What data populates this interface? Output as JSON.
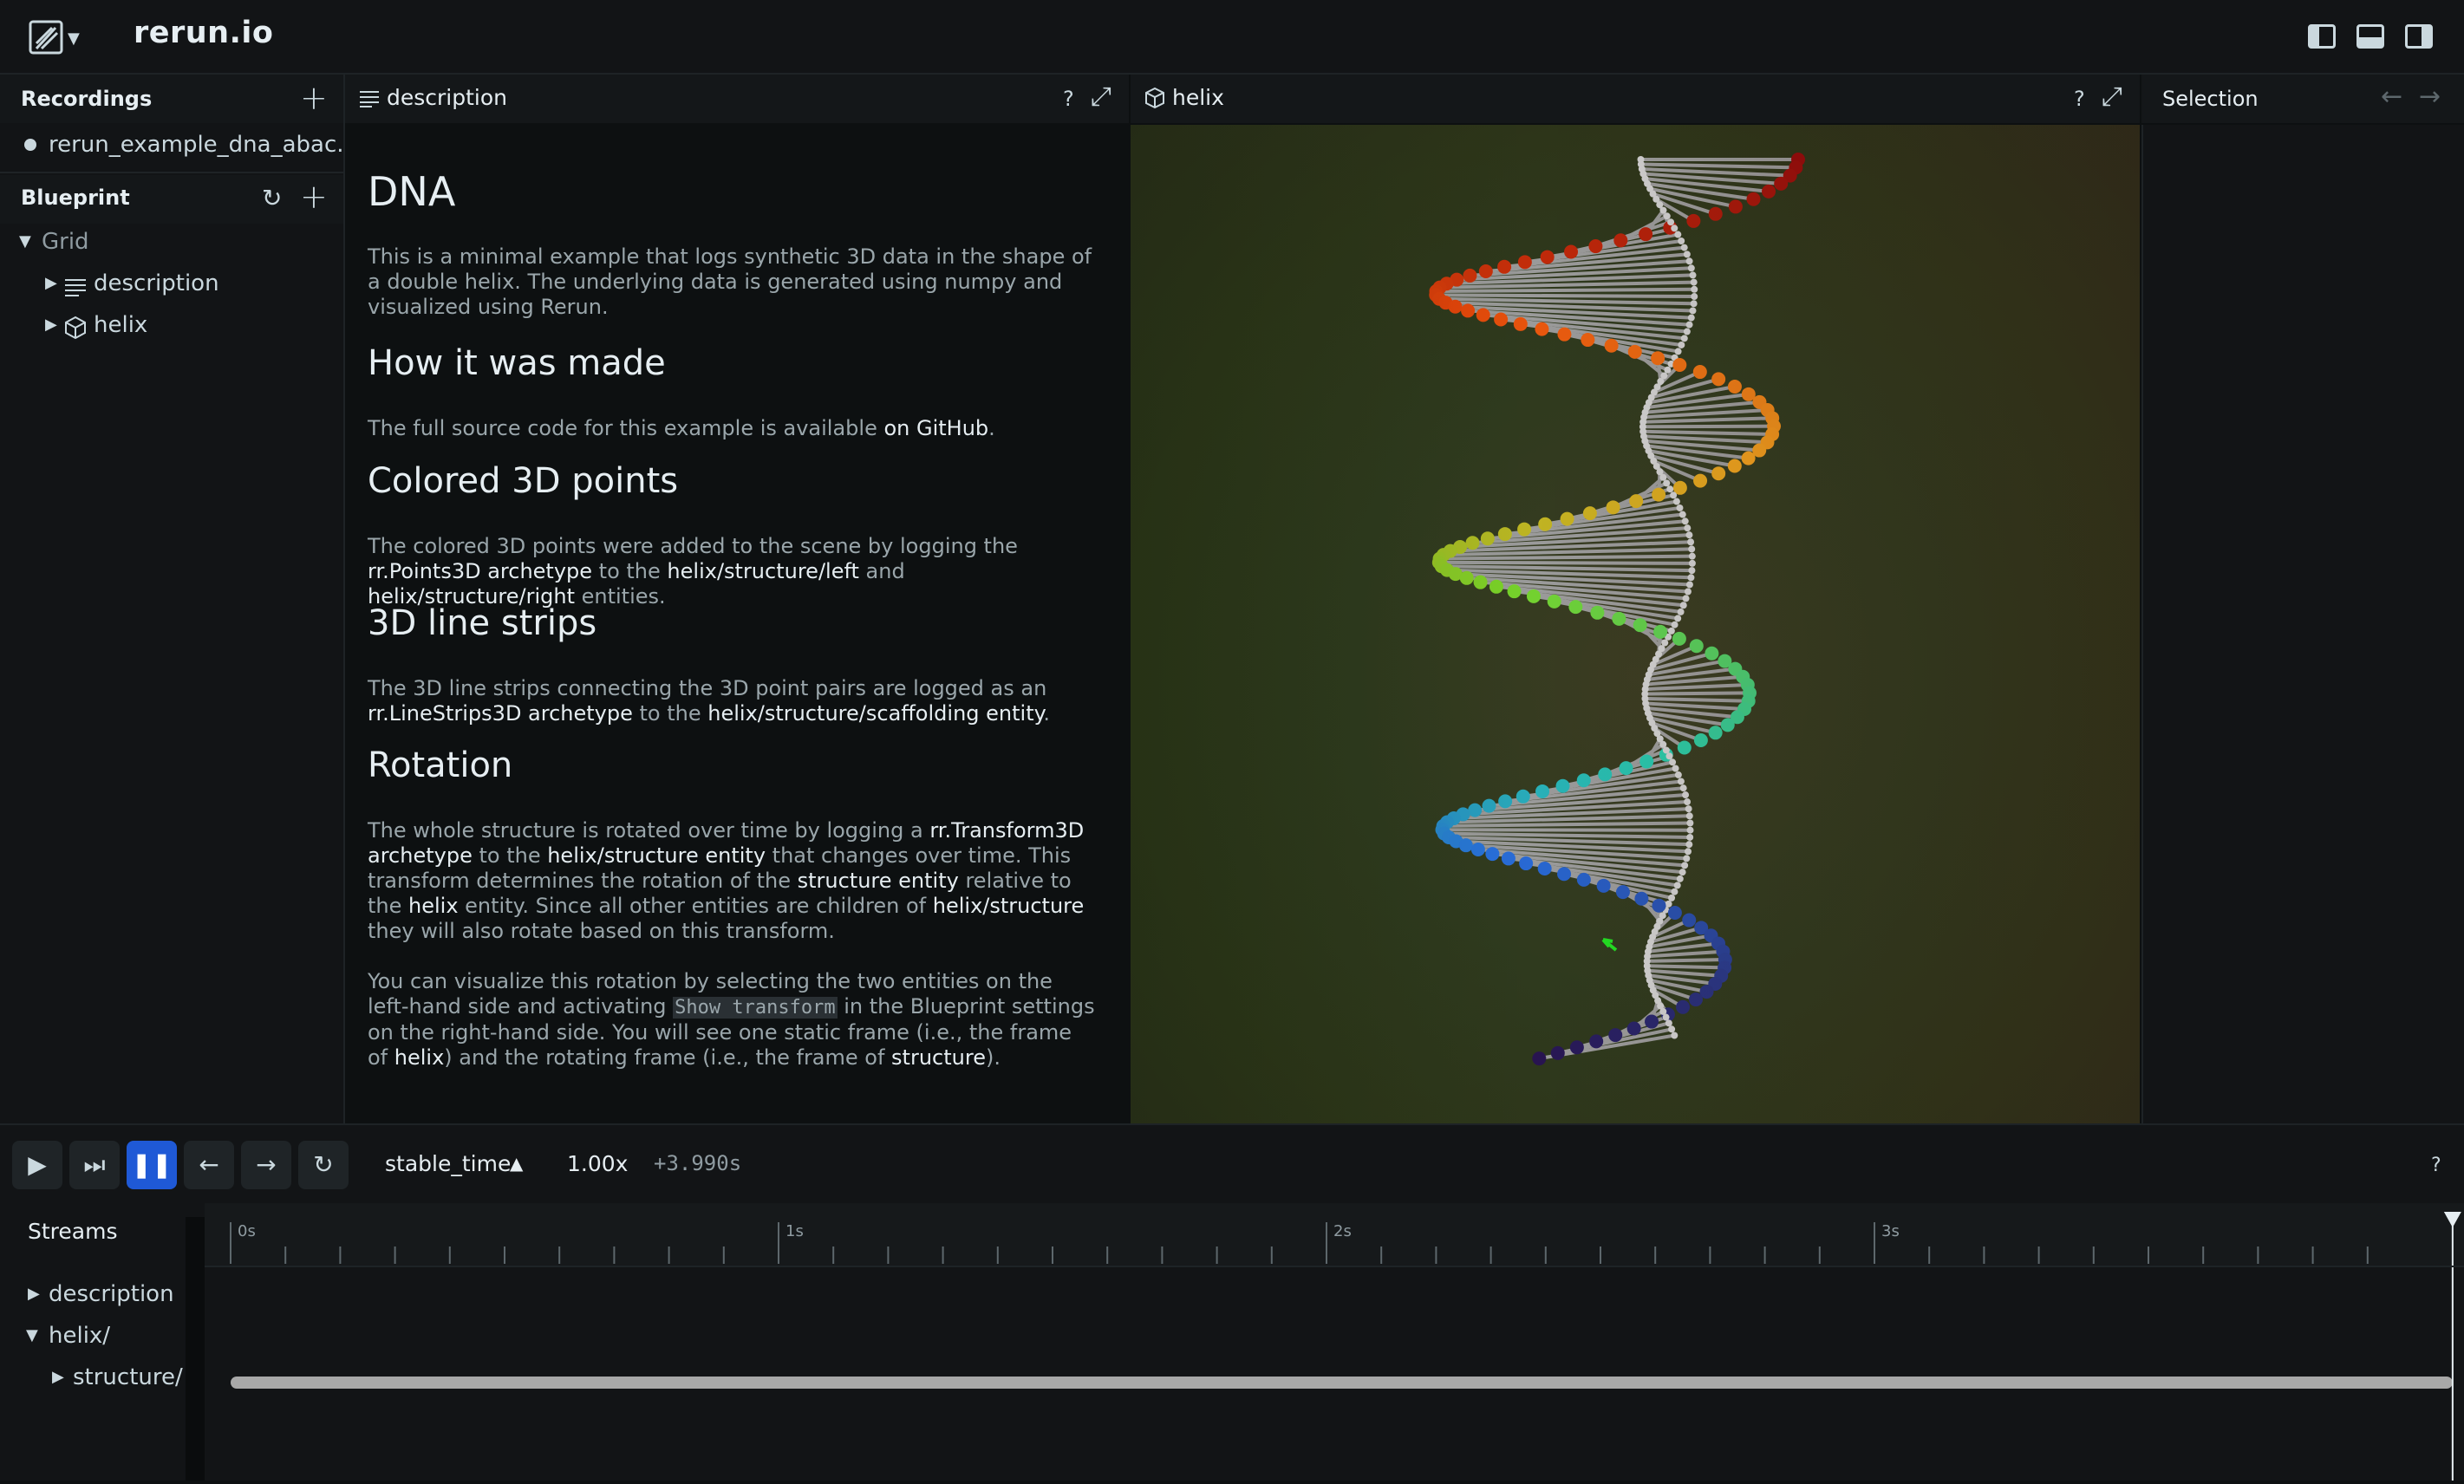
{
  "app": {
    "title": "rerun.io"
  },
  "recordings": {
    "header": "Recordings",
    "items": [
      {
        "label": "rerun_example_dna_abac..."
      }
    ]
  },
  "blueprint": {
    "header": "Blueprint",
    "tree": {
      "root": "Grid",
      "children": [
        {
          "label": "description",
          "icon": "text-icon"
        },
        {
          "label": "helix",
          "icon": "cube-icon"
        }
      ]
    }
  },
  "description_view": {
    "tab": "description",
    "help": "?",
    "md": {
      "h_dna": "DNA",
      "p_dna": "This is a minimal example that logs synthetic 3D data in the shape of a double helix. The underlying data is generated using numpy and visualized using Rerun.",
      "h_made": "How it was made",
      "p_made_pre": "The full source code for this example is available ",
      "p_made_link": "on GitHub",
      "p_made_post": ".",
      "h_points": "Colored 3D points",
      "p_points": {
        "t1": "The colored 3D points were added to the scene by logging the ",
        "b1": "rr.Points3D archetype",
        "t2": " to the ",
        "b2": "helix/structure/left",
        "t3": " and ",
        "b3": "helix/structure/right",
        "t4": " entities."
      },
      "h_lines": "3D line strips",
      "p_lines": {
        "t1": "The 3D line strips connecting the 3D point pairs are logged as an ",
        "b1": "rr.LineStrips3D archetype",
        "t2": " to the ",
        "b2": "helix/structure/scaffolding entity",
        "t3": "."
      },
      "h_rot": "Rotation",
      "p_rot1": {
        "t1": "The whole structure is rotated over time by logging a ",
        "b1": "rr.Transform3D archetype",
        "t2": " to the ",
        "b2": "helix/structure entity",
        "t3": " that changes over time. This transform determines the rotation of the ",
        "b3": "structure entity",
        "t4": " relative to the ",
        "b4": "helix",
        "t5": " entity. Since all other entities are children of ",
        "b5": "helix/structure",
        "t6": " they will also rotate based on this transform."
      },
      "p_rot2": {
        "t1": "You can visualize this rotation by selecting the two entities on the left-hand side and activating ",
        "code": "Show transform",
        "t2": " in the Blueprint settings on the right-hand side. You will see one static frame (i.e., the frame of ",
        "b1": "helix",
        "t3": ") and the rotating frame (i.e., the frame of ",
        "b2": "structure",
        "t4": ")."
      }
    }
  },
  "helix_view": {
    "tab": "helix",
    "help": "?"
  },
  "selection": {
    "header": "Selection"
  },
  "timeline": {
    "timeline_name": "stable_time",
    "speed": "1.00x",
    "offset": "+3.990s",
    "help": "?",
    "ticks": [
      "0s",
      "1s",
      "2s",
      "3s"
    ],
    "playhead_fraction": 0.998
  },
  "streams": {
    "header": "Streams",
    "items": [
      {
        "label": "description"
      },
      {
        "label": "helix/"
      },
      {
        "label": "structure/"
      }
    ]
  }
}
